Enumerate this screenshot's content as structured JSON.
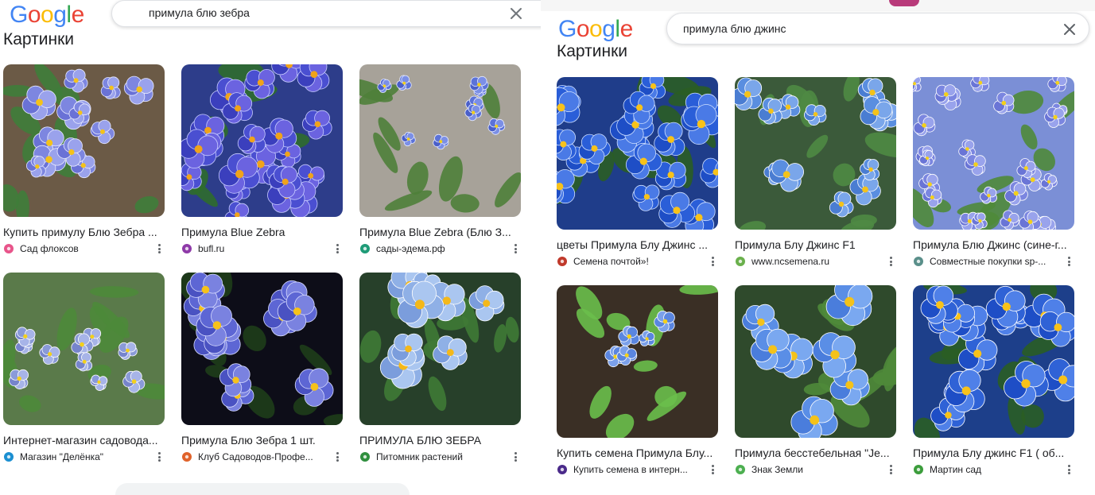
{
  "left": {
    "logo": [
      "G",
      "o",
      "o",
      "g",
      "l",
      "e"
    ],
    "logo_colors": [
      "#4285F4",
      "#EA4335",
      "#FBBC05",
      "#4285F4",
      "#34A853",
      "#EA4335"
    ],
    "search_value": "примула блю зебра",
    "section_title": "Картинки",
    "results": [
      {
        "title": "Купить примулу Блю Зебра ...",
        "source": "Сад флоксов",
        "icon": "flower-favicon",
        "icon_color": "#e8548a"
      },
      {
        "title": "Примула Blue Zebra",
        "source": "bufl.ru",
        "icon": "flame-favicon",
        "icon_color": "#8e3aa8"
      },
      {
        "title": "Примула Blue Zebra (Блю З...",
        "source": "сады-эдема.рф",
        "icon": "tree-favicon",
        "icon_color": "#1e9b77"
      },
      {
        "title": "Интернет-магазин садовода...",
        "source": "Магазин \"Делёнка\"",
        "icon": "leaf-favicon",
        "icon_color": "#1b8fd1"
      },
      {
        "title": "Примула Блю Зебра 1 шт.",
        "source": "Клуб Садоводов-Профе...",
        "icon": "club-favicon",
        "icon_color": "#e0622a"
      },
      {
        "title": "ПРИМУЛА БЛЮ ЗЕБРА",
        "source": "Питомник растений",
        "icon": "plant-favicon",
        "icon_color": "#2f8f3e"
      }
    ]
  },
  "right": {
    "logo": [
      "G",
      "o",
      "o",
      "g",
      "l",
      "e"
    ],
    "logo_colors": [
      "#4285F4",
      "#EA4335",
      "#FBBC05",
      "#4285F4",
      "#34A853",
      "#EA4335"
    ],
    "search_value": "примула блю джинс",
    "section_title": "Картинки",
    "results": [
      {
        "title": "цветы Примула Блу Джинс ...",
        "source": "Семена почтой»!",
        "icon": "seed-favicon",
        "icon_color": "#c0392b"
      },
      {
        "title": "Примула Блу Джинс F1",
        "source": "www.ncsemena.ru",
        "icon": "circle-favicon",
        "icon_color": "#6ab04c"
      },
      {
        "title": "Примула Блю Джинс (сине-г...",
        "source": "Совместные покупки sp-...",
        "icon": "group-favicon",
        "icon_color": "#5a8f8a"
      },
      {
        "title": "Купить семена Примула Блу...",
        "source": "Купить семена в интерн...",
        "icon": "t-favicon",
        "icon_color": "#4a2a8a"
      },
      {
        "title": "Примула бесстебельная \"Je...",
        "source": "Знак Земли",
        "icon": "leaf2-favicon",
        "icon_color": "#4caf50"
      },
      {
        "title": "Примула Блу джинс F1 ( об...",
        "source": "Мартин сад",
        "icon": "tree2-favicon",
        "icon_color": "#3c9d3c"
      }
    ]
  }
}
